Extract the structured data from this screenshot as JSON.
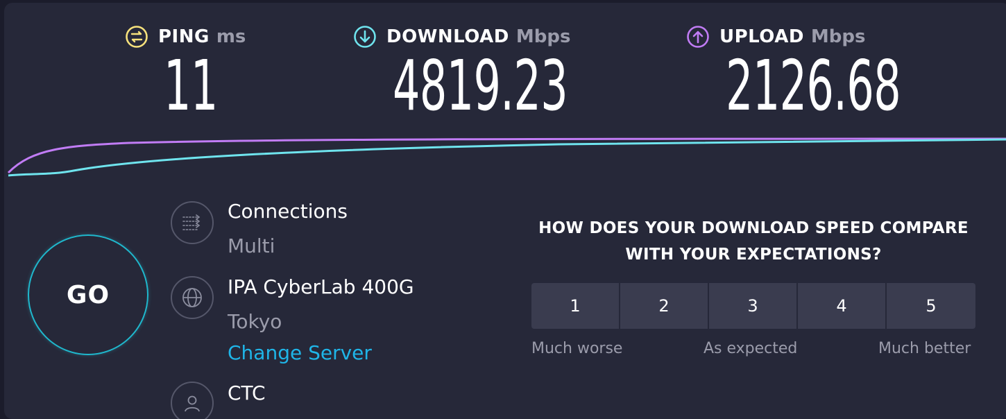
{
  "metrics": {
    "ping": {
      "name": "PING",
      "unit": "ms",
      "value": "11",
      "color": "#f7e27c"
    },
    "download": {
      "name": "DOWNLOAD",
      "unit": "Mbps",
      "value": "4819.23",
      "color": "#6fe4ee"
    },
    "upload": {
      "name": "UPLOAD",
      "unit": "Mbps",
      "value": "2126.68",
      "color": "#c17cf5"
    }
  },
  "go_button": {
    "label": "GO"
  },
  "connections": {
    "title": "Connections",
    "value": "Multi",
    "icon": "connections-icon"
  },
  "server": {
    "title": "IPA CyberLab 400G",
    "location": "Tokyo",
    "change_label": "Change Server",
    "icon": "globe-icon"
  },
  "provider": {
    "title": "CTC",
    "icon": "user-icon"
  },
  "survey": {
    "question_line1": "HOW DOES YOUR DOWNLOAD SPEED COMPARE",
    "question_line2": "WITH YOUR EXPECTATIONS?",
    "options": [
      "1",
      "2",
      "3",
      "4",
      "5"
    ],
    "scale_low": "Much worse",
    "scale_mid": "As expected",
    "scale_high": "Much better"
  },
  "colors": {
    "background": "#262839",
    "accent": "#1fb5e8",
    "go_ring": "#1fb8cd",
    "download_line": "#6fe4ee",
    "upload_line": "#c17cf5"
  }
}
